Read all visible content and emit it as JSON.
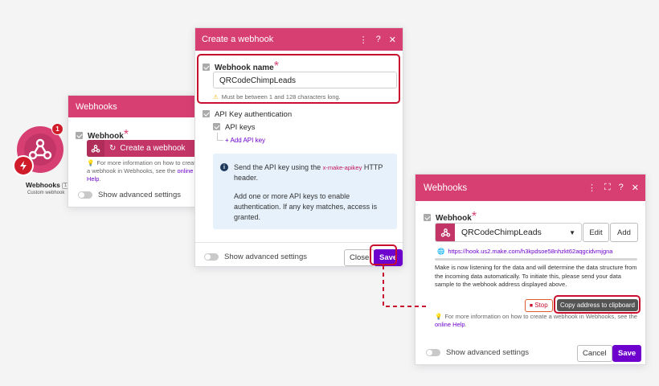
{
  "node": {
    "badge": "1",
    "title": "Webhooks",
    "number": "1",
    "subtitle": "Custom webhook"
  },
  "left_panel": {
    "title": "Webhooks",
    "field_label": "Webhook",
    "required": "*",
    "create_button": "Create a webhook",
    "help_prefix": "For more information on how to create a webhook in Webhooks, see the",
    "help_link": "online Help",
    "help_suffix": ".",
    "advanced": "Show advanced settings"
  },
  "create_panel": {
    "title": "Create a webhook",
    "name_label": "Webhook name",
    "required": "*",
    "name_value": "QRCodeChimpLeads",
    "name_hint": "Must be between 1 and 128 characters long.",
    "api_auth_label": "API Key authentication",
    "api_keys_label": "API keys",
    "add_api_key": "Add API key",
    "info_part1": "Send the API key using the",
    "info_header": "x-make-apikey",
    "info_part2": "HTTP header.",
    "info_part3": "Add one or more API keys to enable authentication. If any key matches, access is granted.",
    "advanced": "Show advanced settings",
    "close": "Close",
    "save": "Save"
  },
  "right_panel": {
    "title": "Webhooks",
    "field_label": "Webhook",
    "required": "*",
    "selected": "QRCodeChimpLeads",
    "edit": "Edit",
    "add": "Add",
    "url": "https://hook.us2.make.com/h3kpdsoe58nhzkt62aqgcidvmjgna",
    "listening": "Make is now listening for the data and will determine the data structure from the incoming data automatically. To initiate this, please send your data sample to the webhook address displayed above.",
    "stop": "Stop",
    "copy": "Copy address to clipboard",
    "help_prefix": "For more information on how to create a webhook in Webhooks, see the",
    "help_link": "online Help",
    "help_suffix": ".",
    "advanced": "Show advanced settings",
    "cancel": "Cancel",
    "save": "Save"
  },
  "colors": {
    "brand": "#d73f72",
    "primary": "#6d00cc",
    "highlight": "#c8102e"
  }
}
